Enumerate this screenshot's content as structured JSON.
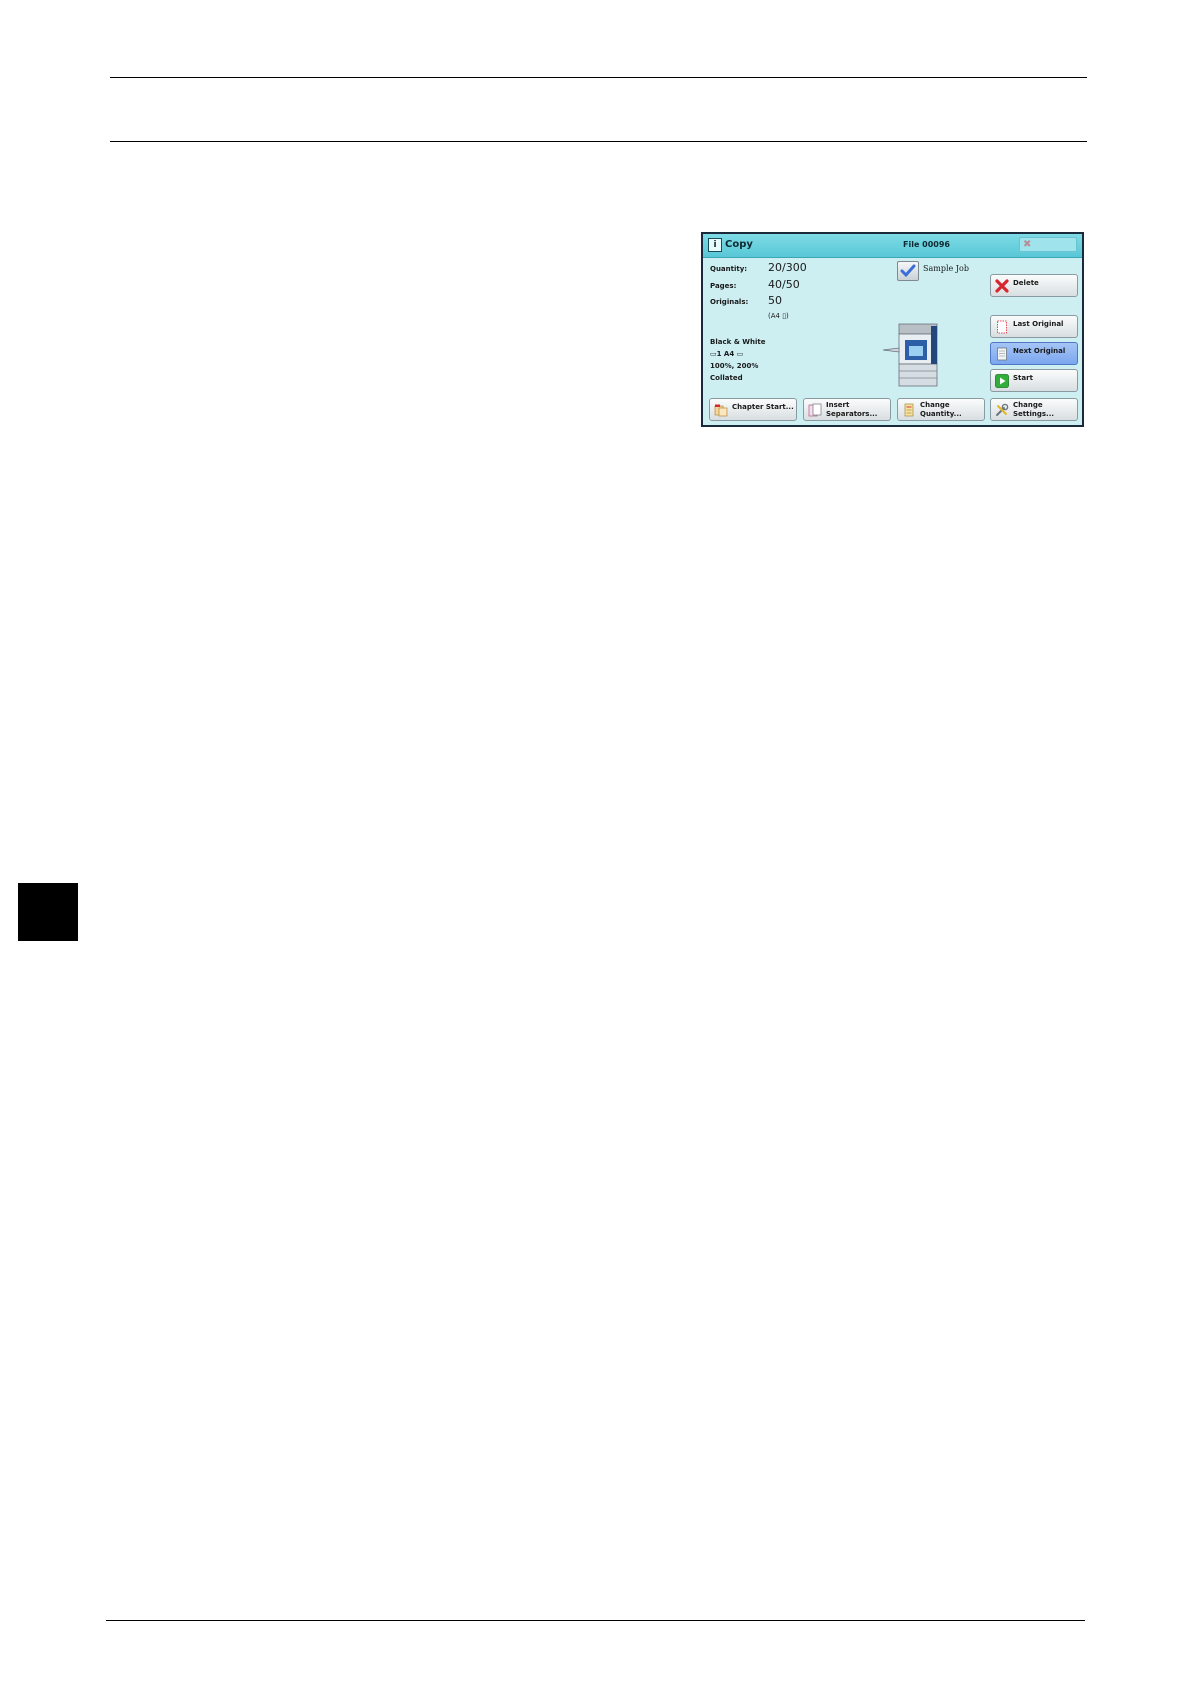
{
  "screen": {
    "title": "Copy",
    "file": "File 00096",
    "info": {
      "quantity_label": "Quantity:",
      "quantity_value": "20/300",
      "pages_label": "Pages:",
      "pages_value": "40/50",
      "originals_label": "Originals:",
      "originals_value": "50",
      "paper": "(A4 ▯)",
      "color_mode": "Black & White",
      "tray": "▭1  A4 ▭",
      "ratio": "100%, 200%",
      "output": "Collated"
    },
    "sample_job_label": "Sample Job",
    "buttons": {
      "delete": "Delete",
      "last_original": "Last Original",
      "next_original": "Next Original",
      "start": "Start",
      "chapter_start": "Chapter Start...",
      "insert_separators_1": "Insert",
      "insert_separators_2": "Separators...",
      "change_quantity_1": "Change",
      "change_quantity_2": "Quantity...",
      "change_settings_1": "Change",
      "change_settings_2": "Settings..."
    },
    "icons": {
      "info": "info-icon",
      "close": "close-icon",
      "check": "check-icon",
      "delete": "delete-x-icon",
      "last_original": "page-outline-icon",
      "next_original": "page-icon",
      "start": "play-icon",
      "chapter_start": "chapter-icon",
      "insert_separators": "separator-icon",
      "change_quantity": "quantity-icon",
      "change_settings": "settings-icon",
      "printer": "printer-illustration"
    },
    "colors": {
      "background": "#cdeff2",
      "titlebar": "#58c7d6",
      "selected_button": "#7ba6ee"
    }
  }
}
